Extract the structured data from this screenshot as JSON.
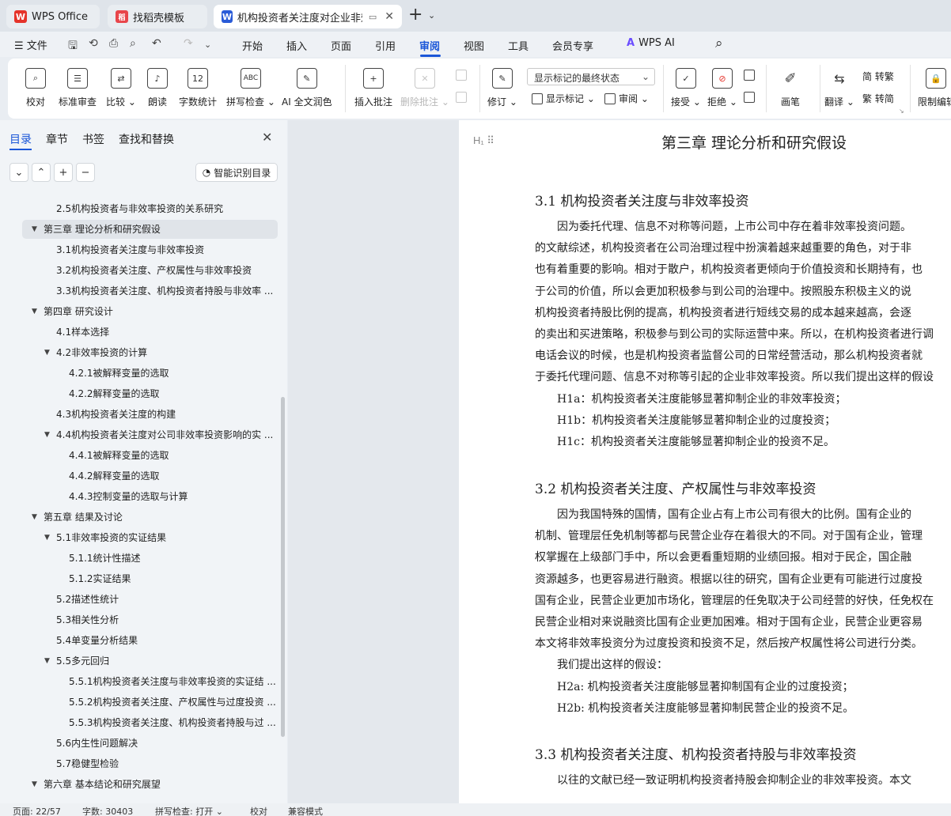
{
  "tabs": [
    {
      "label": "WPS Office",
      "logo": "W"
    },
    {
      "label": "找稻壳模板",
      "logo": "稻"
    },
    {
      "label": "机构投资者关注度对企业非效率",
      "logo": "W"
    }
  ],
  "menu": {
    "file": "文件",
    "items": [
      "开始",
      "插入",
      "页面",
      "引用",
      "审阅",
      "视图",
      "工具",
      "会员专享"
    ],
    "active": "审阅",
    "wps_ai": "WPS AI"
  },
  "ribbon": {
    "proofread": "校对",
    "standard_review": "标准审查",
    "compare": "比较",
    "read_aloud": "朗读",
    "word_count": "字数统计",
    "spell_check": "拼写检查",
    "ai_polish": "AI 全文润色",
    "insert_comment": "插入批注",
    "delete_comment": "删除批注",
    "revise": "修订",
    "markup_mode": "显示标记的最终状态",
    "show_markup": "显示标记",
    "review": "审阅",
    "accept": "接受",
    "reject": "拒绝",
    "pen": "画笔",
    "translate": "翻译",
    "to_traditional": "简 转繁",
    "to_simplified": "繁 转简",
    "restrict_editing": "限制编辑"
  },
  "nav": {
    "tabs": [
      "目录",
      "章节",
      "书签",
      "查找和替换"
    ],
    "smart_toc": "智能识别目录",
    "toc": [
      {
        "text": "2.5机构投资者与非效率投资的关系研究",
        "level": 2,
        "caret": ""
      },
      {
        "text": "第三章  理论分析和研究假设",
        "level": 1,
        "caret": "▼",
        "selected": true
      },
      {
        "text": "3.1机构投资者关注度与非效率投资",
        "level": 2,
        "caret": ""
      },
      {
        "text": "3.2机构投资者关注度、产权属性与非效率投资",
        "level": 2,
        "caret": ""
      },
      {
        "text": "3.3机构投资者关注度、机构投资者持股与非效率 ...",
        "level": 2,
        "caret": ""
      },
      {
        "text": "第四章  研究设计",
        "level": 1,
        "caret": "▼"
      },
      {
        "text": "4.1样本选择",
        "level": 2,
        "caret": ""
      },
      {
        "text": "4.2非效率投资的计算",
        "level": 2,
        "caret": "▼"
      },
      {
        "text": "4.2.1被解释变量的选取",
        "level": 3,
        "caret": ""
      },
      {
        "text": "4.2.2解释变量的选取",
        "level": 3,
        "caret": ""
      },
      {
        "text": "4.3机构投资者关注度的构建",
        "level": 2,
        "caret": ""
      },
      {
        "text": "4.4机构投资者关注度对公司非效率投资影响的实 ...",
        "level": 2,
        "caret": "▼"
      },
      {
        "text": "4.4.1被解释变量的选取",
        "level": 3,
        "caret": ""
      },
      {
        "text": "4.4.2解释变量的选取",
        "level": 3,
        "caret": ""
      },
      {
        "text": "4.4.3控制变量的选取与计算",
        "level": 3,
        "caret": ""
      },
      {
        "text": "第五章  结果及讨论",
        "level": 1,
        "caret": "▼"
      },
      {
        "text": "5.1非效率投资的实证结果",
        "level": 2,
        "caret": "▼"
      },
      {
        "text": "5.1.1统计性描述",
        "level": 3,
        "caret": ""
      },
      {
        "text": "5.1.2实证结果",
        "level": 3,
        "caret": ""
      },
      {
        "text": "5.2描述性统计",
        "level": 2,
        "caret": ""
      },
      {
        "text": "5.3相关性分析",
        "level": 2,
        "caret": ""
      },
      {
        "text": "5.4单变量分析结果",
        "level": 2,
        "caret": ""
      },
      {
        "text": "5.5多元回归",
        "level": 2,
        "caret": "▼"
      },
      {
        "text": "5.5.1机构投资者关注度与非效率投资的实证结 ...",
        "level": 3,
        "caret": ""
      },
      {
        "text": "5.5.2机构投资者关注度、产权属性与过度投资 ...",
        "level": 3,
        "caret": ""
      },
      {
        "text": "5.5.3机构投资者关注度、机构投资者持股与过 ...",
        "level": 3,
        "caret": ""
      },
      {
        "text": "5.6内生性问题解决",
        "level": 2,
        "caret": ""
      },
      {
        "text": "5.7稳健型检验",
        "level": 2,
        "caret": ""
      },
      {
        "text": "第六章  基本结论和研究展望",
        "level": 1,
        "caret": "▼"
      }
    ]
  },
  "document": {
    "chapter_title": "第三章    理论分析和研究假设",
    "sections": [
      {
        "title": "3.1    机构投资者关注度与非效率投资",
        "lines": [
          {
            "text": "因为委托代理、信息不对称等问题，上市公司中存在着非效率投资问题。",
            "indent": true
          },
          {
            "text": "的文献综述，机构投资者在公司治理过程中扮演着越来越重要的角色，对于非",
            "indent": false
          },
          {
            "text": "也有着重要的影响。相对于散户，机构投资者更倾向于价值投资和长期持有，也",
            "indent": false
          },
          {
            "text": "于公司的价值，所以会更加积极参与到公司的治理中。按照股东积极主义的说",
            "indent": false
          },
          {
            "text": "机构投资者持股比例的提高，机构投资者进行短线交易的成本越来越高，会逐",
            "indent": false
          },
          {
            "text": "的卖出和买进策略，积极参与到公司的实际运营中来。所以，在机构投资者进行调",
            "indent": false
          },
          {
            "text": "电话会议的时候，也是机构投资者监督公司的日常经营活动，那么机构投资者就",
            "indent": false
          },
          {
            "text": "于委托代理问题、信息不对称等引起的企业非效率投资。所以我们提出这样的假设",
            "indent": false
          },
          {
            "text": "H1a：机构投资者关注度能够显著抑制企业的非效率投资；",
            "indent": true
          },
          {
            "text": "H1b：机构投资者关注度能够显著抑制企业的过度投资；",
            "indent": true
          },
          {
            "text": "H1c：机构投资者关注度能够显著抑制企业的投资不足。",
            "indent": true
          }
        ]
      },
      {
        "title": "3.2    机构投资者关注度、产权属性与非效率投资",
        "lines": [
          {
            "text": "因为我国特殊的国情，国有企业占有上市公司有很大的比例。国有企业的",
            "indent": true
          },
          {
            "text": "机制、管理层任免机制等都与民营企业存在着很大的不同。对于国有企业，管理",
            "indent": false
          },
          {
            "text": "权掌握在上级部门手中，所以会更看重短期的业绩回报。相对于民企，国企融",
            "indent": false
          },
          {
            "text": "资源越多，也更容易进行融资。根据以往的研究，国有企业更有可能进行过度投",
            "indent": false
          },
          {
            "text": "国有企业，民营企业更加市场化，管理层的任免取决于公司经营的好快，任免权在",
            "indent": false
          },
          {
            "text": "民营企业相对来说融资比国有企业更加困难。相对于国有企业，民营企业更容易",
            "indent": false
          },
          {
            "text": "本文将非效率投资分为过度投资和投资不足，然后按产权属性将公司进行分类。",
            "indent": false
          },
          {
            "text": "我们提出这样的假设：",
            "indent": true
          },
          {
            "text": "H2a: 机构投资者关注度能够显著抑制国有企业的过度投资；",
            "indent": true
          },
          {
            "text": "H2b: 机构投资者关注度能够显著抑制民营企业的投资不足。",
            "indent": true
          }
        ]
      },
      {
        "title": "3.3    机构投资者关注度、机构投资者持股与非效率投资",
        "lines": [
          {
            "text": "以往的文献已经一致证明机构投资者持股会抑制企业的非效率投资。本文",
            "indent": true
          }
        ]
      }
    ]
  },
  "status": {
    "page": "页面: 22/57",
    "words": "字数: 30403",
    "spell": "拼写检查: 打开",
    "proof": "校对",
    "compat": "兼容模式"
  },
  "colors": {
    "accent": "#1a56d8",
    "wps_red": "#e5332a",
    "docer_red": "#e8454a",
    "writer_blue": "#2a5bd7",
    "ai_purple": "#6b4dff"
  }
}
